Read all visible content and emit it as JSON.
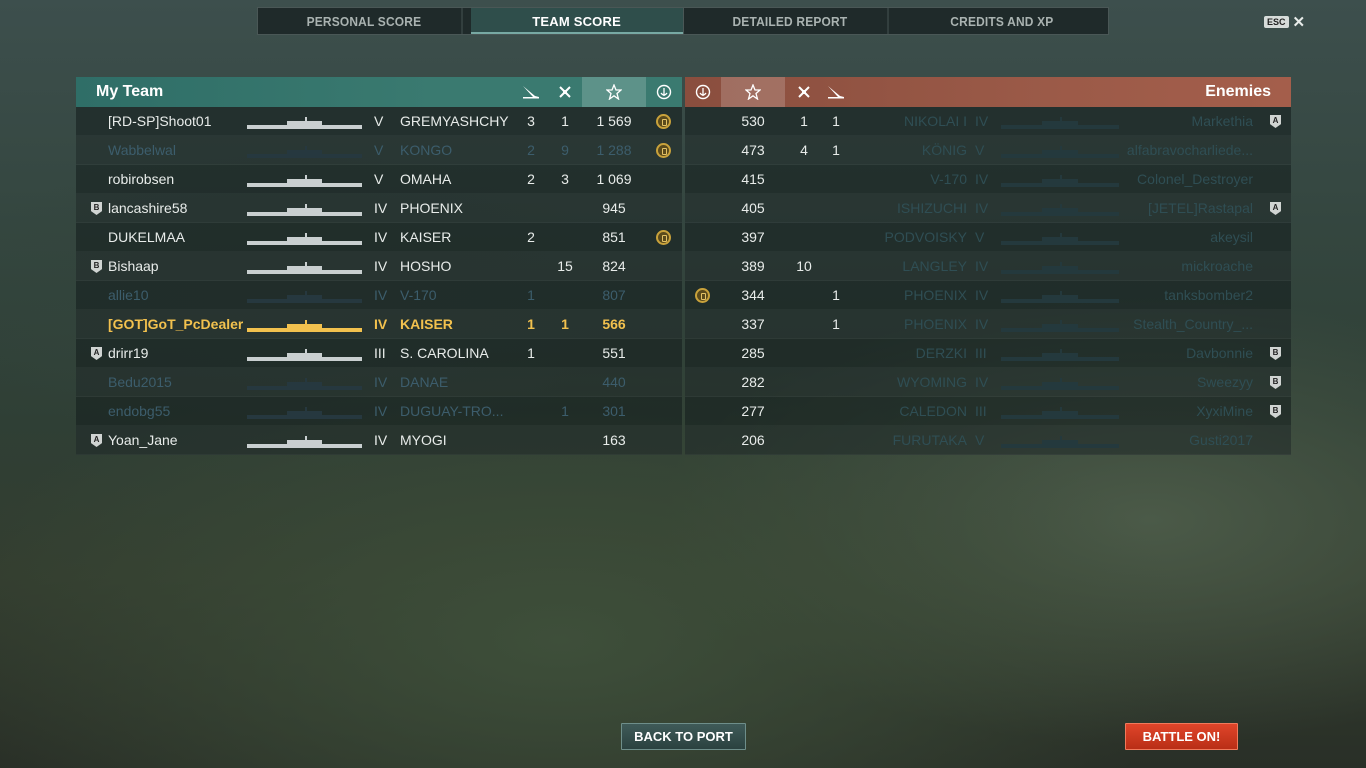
{
  "tabs": [
    {
      "label": "PERSONAL SCORE"
    },
    {
      "label": "TEAM SCORE"
    },
    {
      "label": "DETAILED REPORT"
    },
    {
      "label": "CREDITS AND XP"
    }
  ],
  "active_tab": "TEAM SCORE",
  "esc": {
    "key_label": "ESC",
    "close_glyph": "✕"
  },
  "my_team": {
    "title": "My Team",
    "colors": {
      "header": "#3a7a70",
      "alive": "#e8ecea",
      "dead": "#3c5d6c",
      "self": "#f2c14e"
    },
    "rows": [
      {
        "badge": "",
        "player": "[RD-SP]Shoot01",
        "tier": "V",
        "ship": "GREMYASHCHY",
        "c1": "3",
        "c2": "1",
        "score": "1 569",
        "medal": true,
        "status": "alive"
      },
      {
        "badge": "",
        "player": "Wabbelwal",
        "tier": "V",
        "ship": "KONGO",
        "c1": "2",
        "c2": "9",
        "score": "1 288",
        "medal": true,
        "status": "dead"
      },
      {
        "badge": "",
        "player": "robirobsen",
        "tier": "V",
        "ship": "OMAHA",
        "c1": "2",
        "c2": "3",
        "score": "1 069",
        "medal": false,
        "status": "alive"
      },
      {
        "badge": "B",
        "player": "lancashire58",
        "tier": "IV",
        "ship": "PHOENIX",
        "c1": "",
        "c2": "",
        "score": "945",
        "medal": false,
        "status": "alive"
      },
      {
        "badge": "",
        "player": "DUKELMAA",
        "tier": "IV",
        "ship": "KAISER",
        "c1": "2",
        "c2": "",
        "score": "851",
        "medal": true,
        "status": "alive"
      },
      {
        "badge": "B",
        "player": "Bishaap",
        "tier": "IV",
        "ship": "HOSHO",
        "c1": "",
        "c2": "15",
        "score": "824",
        "medal": false,
        "status": "alive"
      },
      {
        "badge": "",
        "player": "allie10",
        "tier": "IV",
        "ship": "V-170",
        "c1": "1",
        "c2": "",
        "score": "807",
        "medal": false,
        "status": "dead"
      },
      {
        "badge": "",
        "player": "[GOT]GoT_PcDealer",
        "tier": "IV",
        "ship": "KAISER",
        "c1": "1",
        "c2": "1",
        "score": "566",
        "medal": false,
        "status": "self"
      },
      {
        "badge": "A",
        "player": "drirr19",
        "tier": "III",
        "ship": "S. CAROLINA",
        "c1": "1",
        "c2": "",
        "score": "551",
        "medal": false,
        "status": "alive"
      },
      {
        "badge": "",
        "player": "Bedu2015",
        "tier": "IV",
        "ship": "DANAE",
        "c1": "",
        "c2": "",
        "score": "440",
        "medal": false,
        "status": "dead"
      },
      {
        "badge": "",
        "player": "endobg55",
        "tier": "IV",
        "ship": "DUGUAY-TRO...",
        "c1": "",
        "c2": "1",
        "score": "301",
        "medal": false,
        "status": "dead"
      },
      {
        "badge": "A",
        "player": "Yoan_Jane",
        "tier": "IV",
        "ship": "MYOGI",
        "c1": "",
        "c2": "",
        "score": "163",
        "medal": false,
        "status": "alive"
      }
    ]
  },
  "enemies": {
    "title": "Enemies",
    "colors": {
      "header": "#9b5a48"
    },
    "rows": [
      {
        "medal": false,
        "score": "530",
        "c2": "1",
        "c1": "1",
        "ship": "NIKOLAI I",
        "tier": "IV",
        "player": "Markethia",
        "badge": "A"
      },
      {
        "medal": false,
        "score": "473",
        "c2": "4",
        "c1": "1",
        "ship": "KÖNIG",
        "tier": "V",
        "player": "alfabravocharliede...",
        "badge": ""
      },
      {
        "medal": false,
        "score": "415",
        "c2": "",
        "c1": "",
        "ship": "V-170",
        "tier": "IV",
        "player": "Colonel_Destroyer",
        "badge": ""
      },
      {
        "medal": false,
        "score": "405",
        "c2": "",
        "c1": "",
        "ship": "ISHIZUCHI",
        "tier": "IV",
        "player": "[JETEL]Rastapal",
        "badge": "A"
      },
      {
        "medal": false,
        "score": "397",
        "c2": "",
        "c1": "",
        "ship": "PODVOISKY",
        "tier": "V",
        "player": "akeysil",
        "badge": ""
      },
      {
        "medal": false,
        "score": "389",
        "c2": "10",
        "c1": "",
        "ship": "LANGLEY",
        "tier": "IV",
        "player": "mickroache",
        "badge": ""
      },
      {
        "medal": true,
        "score": "344",
        "c2": "",
        "c1": "1",
        "ship": "PHOENIX",
        "tier": "IV",
        "player": "tanksbomber2",
        "badge": ""
      },
      {
        "medal": false,
        "score": "337",
        "c2": "",
        "c1": "1",
        "ship": "PHOENIX",
        "tier": "IV",
        "player": "Stealth_Country_...",
        "badge": ""
      },
      {
        "medal": false,
        "score": "285",
        "c2": "",
        "c1": "",
        "ship": "DERZKI",
        "tier": "III",
        "player": "Davbonnie",
        "badge": "B"
      },
      {
        "medal": false,
        "score": "282",
        "c2": "",
        "c1": "",
        "ship": "WYOMING",
        "tier": "IV",
        "player": "Sweezyy",
        "badge": "B"
      },
      {
        "medal": false,
        "score": "277",
        "c2": "",
        "c1": "",
        "ship": "CALEDON",
        "tier": "III",
        "player": "XyxiMine",
        "badge": "B"
      },
      {
        "medal": false,
        "score": "206",
        "c2": "",
        "c1": "",
        "ship": "FURUTAKA",
        "tier": "V",
        "player": "Gusti2017",
        "badge": ""
      }
    ]
  },
  "column_icons": {
    "kills": "torpedo-hit-icon",
    "planes": "plane-shot-icon",
    "score": "star-icon",
    "medal": "anchor-medal-icon"
  },
  "buttons": {
    "back": "BACK TO PORT",
    "battle": "BATTLE ON!"
  }
}
